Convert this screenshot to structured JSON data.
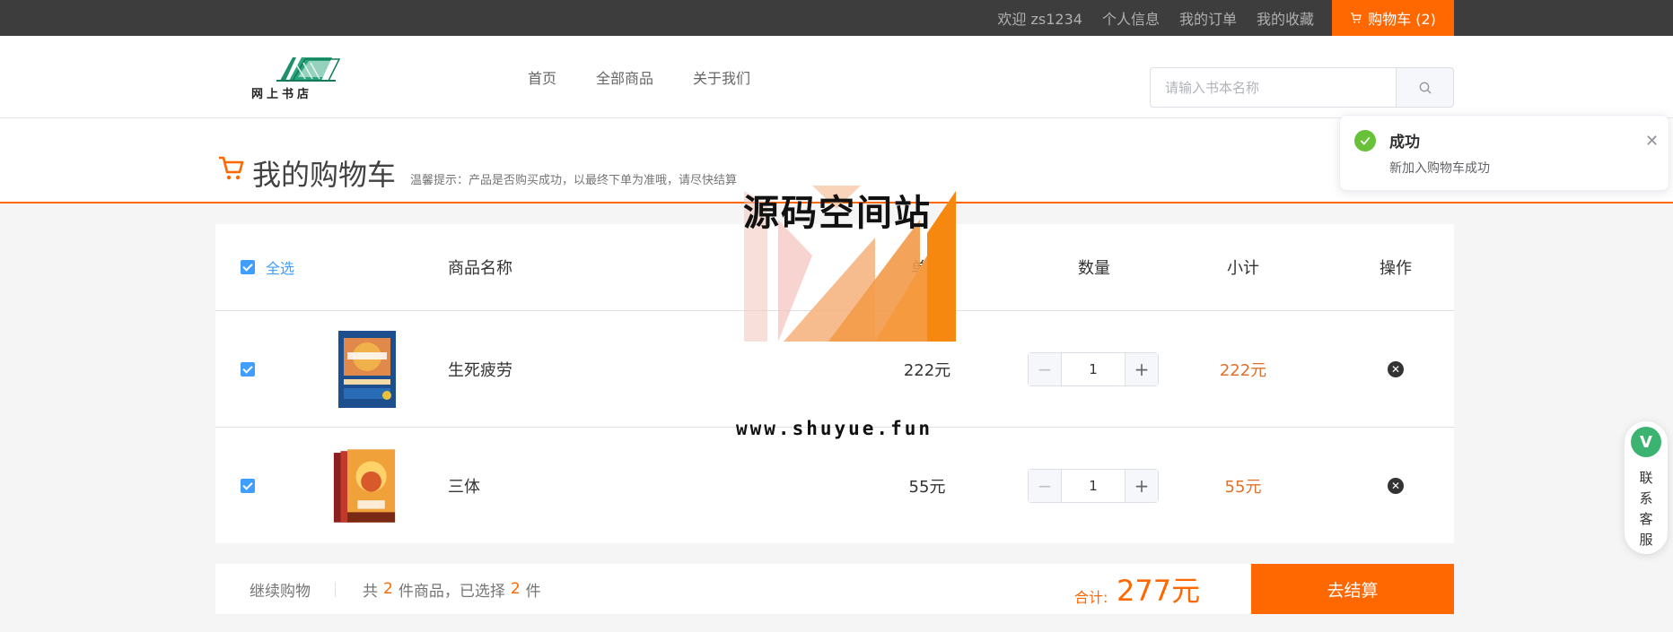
{
  "topbar": {
    "welcome": "欢迎 zs1234",
    "profile": "个人信息",
    "orders": "我的订单",
    "favorites": "我的收藏",
    "cart": "购物车 (2)"
  },
  "header": {
    "logo_text": "网上书店",
    "nav": [
      "首页",
      "全部商品",
      "关于我们"
    ],
    "search_placeholder": "请输入书本名称"
  },
  "titlebar": {
    "title": "我的购物车",
    "tip": "温馨提示：产品是否购买成功，以最终下单为准哦，请尽快结算"
  },
  "table": {
    "headers": {
      "select_all": "全选",
      "name": "商品名称",
      "price": "单价",
      "quantity": "数量",
      "subtotal": "小计",
      "action": "操作"
    },
    "rows": [
      {
        "name": "生死疲劳",
        "price": "222元",
        "quantity": "1",
        "subtotal": "222元",
        "selected": true
      },
      {
        "name": "三体",
        "price": "55元",
        "quantity": "1",
        "subtotal": "55元",
        "selected": true
      }
    ]
  },
  "footer": {
    "continue": "继续购物",
    "count_prefix": "共",
    "count_total": "2",
    "count_mid": "件商品，已选择",
    "count_selected": "2",
    "count_suffix": "件",
    "total_label": "合计:",
    "total": "277元",
    "checkout": "去结算"
  },
  "notification": {
    "title": "成功",
    "message": "新加入购物车成功"
  },
  "service": {
    "badge": "V",
    "label": "联系客服"
  },
  "watermark": {
    "title": "源码空间站",
    "url": "www.shuyue.fun"
  },
  "colors": {
    "accent": "#ff6700",
    "checkbox": "#409eff",
    "success": "#67c23a"
  }
}
